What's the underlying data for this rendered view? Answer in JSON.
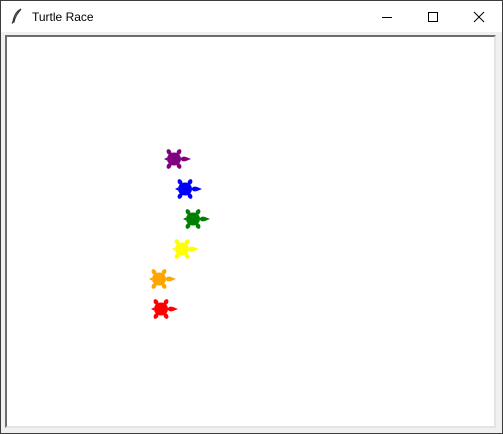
{
  "window": {
    "title": "Turtle Race",
    "app_icon": "feather-icon",
    "controls": {
      "minimize_icon": "minimize-icon",
      "maximize_icon": "maximize-icon",
      "close_icon": "close-icon"
    }
  },
  "canvas": {
    "background": "#ffffff",
    "turtles": [
      {
        "color": "#800080",
        "name": "purple"
      },
      {
        "color": "#0000ff",
        "name": "blue"
      },
      {
        "color": "#008000",
        "name": "green"
      },
      {
        "color": "#ffff00",
        "name": "yellow"
      },
      {
        "color": "#ffa500",
        "name": "orange"
      },
      {
        "color": "#ff0000",
        "name": "red"
      }
    ]
  }
}
